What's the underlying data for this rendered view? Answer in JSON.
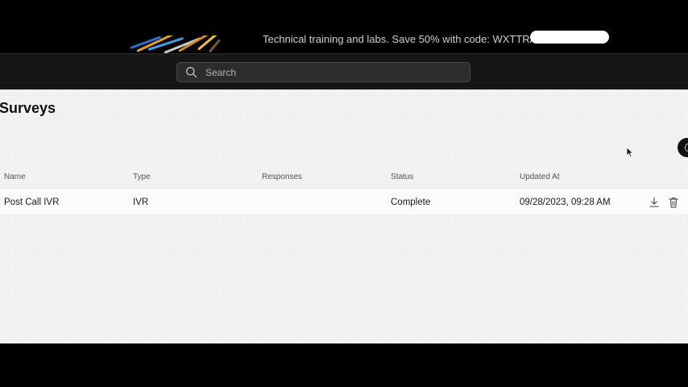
{
  "banner": {
    "text": "Technical training and labs. Save 50% with code: WXTTRAIN30"
  },
  "search": {
    "placeholder": "Search",
    "value": ""
  },
  "page": {
    "title": "Surveys"
  },
  "table": {
    "columns": [
      "Name",
      "Type",
      "Responses",
      "Status",
      "Updated At"
    ],
    "rows": [
      {
        "name": "Post Call IVR",
        "type": "IVR",
        "responses": "",
        "status": "Complete",
        "updated_at": "09/28/2023, 09:28 AM"
      }
    ]
  },
  "icons": {
    "search": "search-icon",
    "download": "download-icon",
    "delete": "trash-icon",
    "cursor": "mouse-pointer-icon"
  },
  "colors": {
    "topbar": "#161616",
    "content_bg": "#f3f3f3",
    "title": "#111111"
  }
}
